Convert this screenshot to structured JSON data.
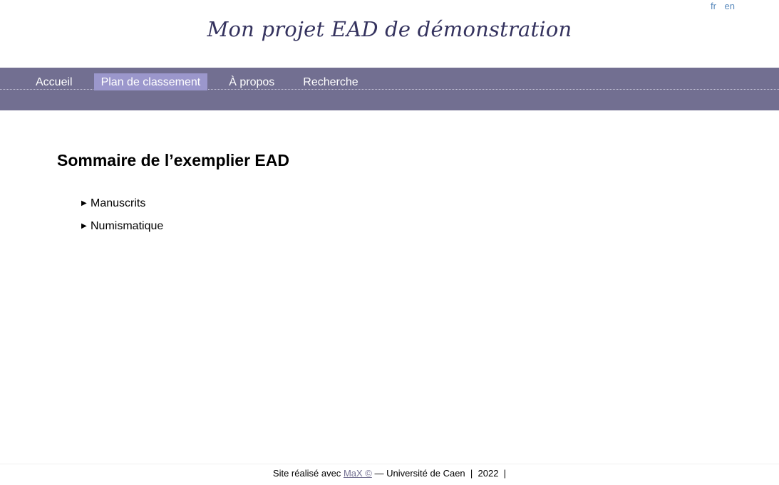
{
  "lang": {
    "fr": "fr",
    "en": "en"
  },
  "header": {
    "title": "Mon projet EAD de démonstration"
  },
  "nav": {
    "items": [
      {
        "label": "Accueil"
      },
      {
        "label": "Plan de classement",
        "active": true
      },
      {
        "label": "À propos"
      },
      {
        "label": "Recherche"
      }
    ]
  },
  "main": {
    "title": "Sommaire de l’exemplier EAD",
    "toc": [
      {
        "label": "Manuscrits"
      },
      {
        "label": "Numismatique"
      }
    ]
  },
  "footer": {
    "prefix": "Site réalisé avec",
    "link": "MaX ©",
    "org": "— Université de Caen",
    "sep1": "|",
    "year": "2022",
    "sep2": "|"
  },
  "colors": {
    "nav_bg": "#726f91",
    "nav_active_bg": "#9b97cc",
    "title_color": "#34325e",
    "lang_link": "#5b8bbd"
  },
  "icons": {
    "toc_expand": "triangle-right-icon"
  }
}
